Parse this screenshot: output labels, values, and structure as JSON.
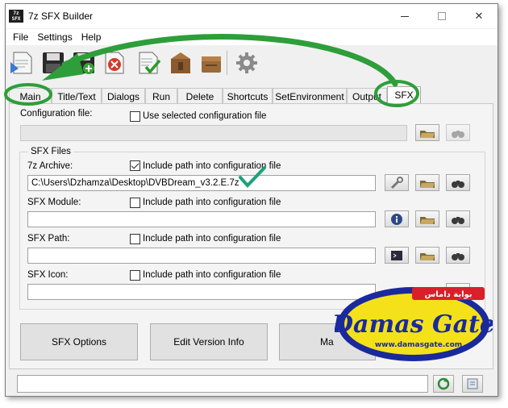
{
  "window": {
    "title": "7z SFX Builder",
    "app_icon_text": "7z SFX"
  },
  "menu": {
    "items": [
      "File",
      "Settings",
      "Help"
    ]
  },
  "toolbar": {
    "buttons": [
      "new-config-icon",
      "save-icon",
      "save-as-icon",
      "delete-icon",
      "check-config-icon",
      "build-archive-icon",
      "package-icon",
      "settings-gear-icon"
    ]
  },
  "tabs": [
    "Main",
    "Title/Text",
    "Dialogs",
    "Run",
    "Delete",
    "Shortcuts",
    "SetEnvironment",
    "Output",
    "SFX"
  ],
  "active_tab": "SFX",
  "config": {
    "label": "Configuration file:",
    "use_selected_label": "Use selected configuration file",
    "value": ""
  },
  "sfx_files": {
    "group_title": "SFX Files",
    "archive": {
      "label": "7z Archive:",
      "checkbox_label": "Include path into configuration file",
      "checked": true,
      "value": "C:\\Users\\Dzhamza\\Desktop\\DVBDream_v3.2.E.7z"
    },
    "module": {
      "label": "SFX Module:",
      "checkbox_label": "Include path into configuration file",
      "checked": false,
      "value": ""
    },
    "path": {
      "label": "SFX Path:",
      "checkbox_label": "Include path into configuration file",
      "checked": false,
      "value": ""
    },
    "icon": {
      "label": "SFX Icon:",
      "checkbox_label": "Include path into configuration file",
      "checked": false,
      "value": ""
    }
  },
  "buttons": {
    "sfx_options": "SFX Options",
    "edit_version_info": "Edit Version Info",
    "make": "Ma"
  },
  "watermark": {
    "arabic": "بوابة داماس",
    "brand": "Damas Gate",
    "url": "www.damasgate.com"
  },
  "colors": {
    "highlight_green": "#2e9e3a",
    "checkmark_teal": "#1aa37a",
    "logo_blue": "#1a2a9c",
    "logo_yellow": "#f5e11a",
    "logo_red": "#d8202a"
  }
}
